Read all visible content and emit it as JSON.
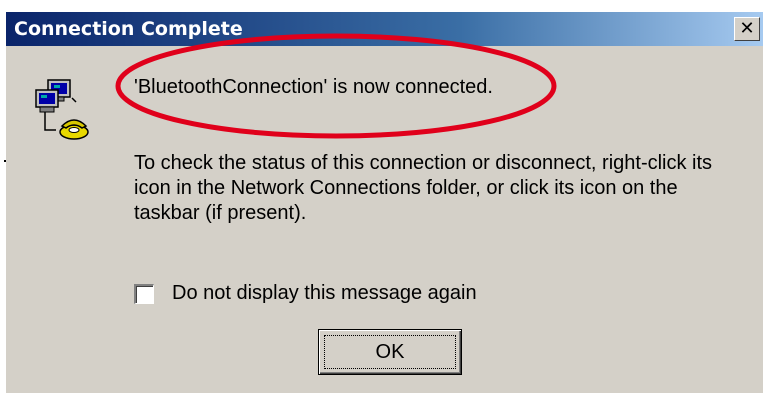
{
  "window": {
    "title": "Connection Complete",
    "close_glyph": "✕",
    "title_gradient_start": "#0a246a",
    "title_gradient_end": "#a6caf0",
    "face_color": "#d4d0c8"
  },
  "icon": "network-connection-icon",
  "message": {
    "main": "'BluetoothConnection' is now connected.",
    "detail": "To check the status of this connection or disconnect, right-click its icon in the Network Connections folder, or click its icon on the taskbar (if present)."
  },
  "highlight": {
    "color": "#e0001b"
  },
  "checkbox": {
    "label": "Do not display this message again",
    "checked": false
  },
  "buttons": {
    "ok_label": "OK"
  }
}
